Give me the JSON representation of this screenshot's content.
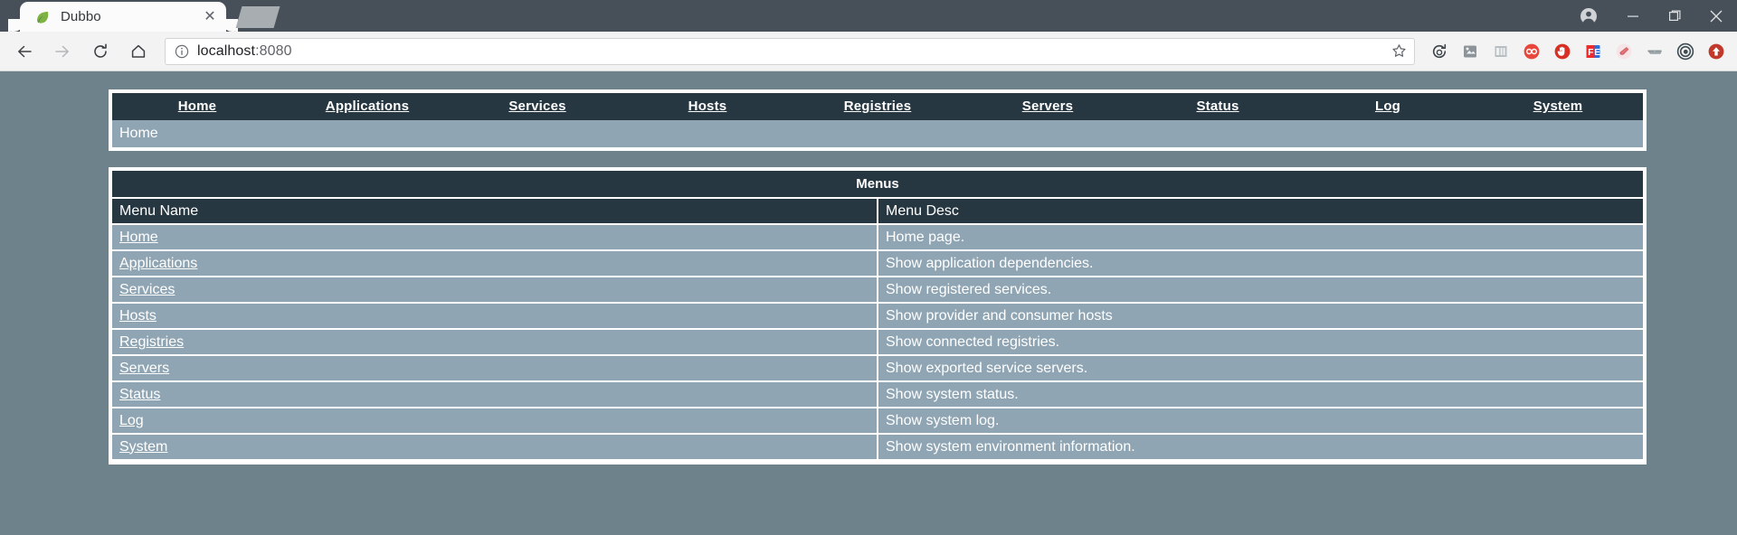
{
  "browser": {
    "tab": {
      "title": "Dubbo",
      "favicon_icon": "leaf-favicon",
      "close_icon": "close-icon"
    },
    "newtab_icon": "new-tab-shape",
    "window": {
      "profile_icon": "profile-avatar-icon",
      "minimize_icon": "minimize-icon",
      "maximize_icon": "maximize-icon",
      "close_icon": "window-close-icon"
    },
    "toolbar": {
      "back_icon": "back-arrow-icon",
      "forward_icon": "forward-arrow-icon",
      "reload_icon": "reload-icon",
      "home_icon": "home-icon",
      "info_icon": "page-info-icon",
      "url_host": "localhost",
      "url_port": ":8080",
      "bookmark_icon": "star-icon",
      "extensions": [
        {
          "name": "history-sync-icon",
          "color": "#4a4a4a"
        },
        {
          "name": "screenshot-icon",
          "color": "#7f8c8d"
        },
        {
          "name": "column-layout-icon",
          "color": "#95a5a6"
        },
        {
          "name": "infinity-icon",
          "color": "#e8483c"
        },
        {
          "name": "stop-hand-icon",
          "color": "#d93025"
        },
        {
          "name": "fe-translate-icon",
          "color": "#2a6fe0"
        },
        {
          "name": "eraser-icon",
          "color": "#e3757a"
        },
        {
          "name": "glasses-icon",
          "color": "#7f8c8d"
        },
        {
          "name": "spiral-icon",
          "color": "#3d4b52"
        },
        {
          "name": "upload-arrow-icon",
          "color": "#c0392b"
        }
      ]
    }
  },
  "site": {
    "nav": [
      {
        "label": "Home"
      },
      {
        "label": "Applications"
      },
      {
        "label": "Services"
      },
      {
        "label": "Hosts"
      },
      {
        "label": "Registries"
      },
      {
        "label": "Servers"
      },
      {
        "label": "Status"
      },
      {
        "label": "Log"
      },
      {
        "label": "System"
      }
    ],
    "breadcrumb": "Home",
    "table": {
      "caption": "Menus",
      "headers": [
        "Menu Name",
        "Menu Desc"
      ],
      "rows": [
        {
          "name": "Home",
          "desc": "Home page."
        },
        {
          "name": "Applications",
          "desc": "Show application dependencies."
        },
        {
          "name": "Services",
          "desc": "Show registered services."
        },
        {
          "name": "Hosts",
          "desc": "Show provider and consumer hosts"
        },
        {
          "name": "Registries",
          "desc": "Show connected registries."
        },
        {
          "name": "Servers",
          "desc": "Show exported service servers."
        },
        {
          "name": "Status",
          "desc": "Show system status."
        },
        {
          "name": "Log",
          "desc": "Show system log."
        },
        {
          "name": "System",
          "desc": "Show system environment information."
        }
      ]
    }
  },
  "colors": {
    "page_background": "#6e828c",
    "header_dark": "#263742",
    "row_light": "#8fa5b3",
    "border_white": "#ffffff",
    "chrome_titlebar": "#474f58"
  }
}
